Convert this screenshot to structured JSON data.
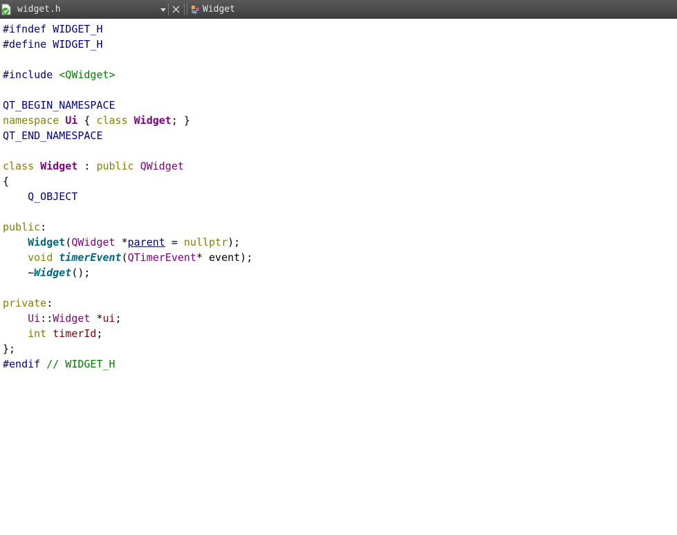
{
  "toolbar": {
    "file_name": "widget.h",
    "symbol_name": "Widget"
  },
  "editor": {
    "lines": [
      [
        {
          "t": "#ifndef WIDGET_H",
          "c": "pp"
        }
      ],
      [
        {
          "t": "#define WIDGET_H",
          "c": "pp"
        }
      ],
      [],
      [
        {
          "t": "#include ",
          "c": "pp"
        },
        {
          "t": "<QWidget>",
          "c": "str"
        }
      ],
      [],
      [
        {
          "t": "QT_BEGIN_NAMESPACE",
          "c": "mac"
        }
      ],
      [
        {
          "t": "namespace",
          "c": "kw"
        },
        {
          "t": " ",
          "c": ""
        },
        {
          "t": "Ui",
          "c": "tyb"
        },
        {
          "t": " { ",
          "c": ""
        },
        {
          "t": "class",
          "c": "kw"
        },
        {
          "t": " ",
          "c": ""
        },
        {
          "t": "Widget",
          "c": "tyb"
        },
        {
          "t": "; }",
          "c": ""
        }
      ],
      [
        {
          "t": "QT_END_NAMESPACE",
          "c": "mac"
        }
      ],
      [],
      [
        {
          "t": "class",
          "c": "kw"
        },
        {
          "t": " ",
          "c": ""
        },
        {
          "t": "Widget",
          "c": "tyb"
        },
        {
          "t": " : ",
          "c": ""
        },
        {
          "t": "public",
          "c": "kw"
        },
        {
          "t": " ",
          "c": ""
        },
        {
          "t": "QWidget",
          "c": "ty"
        }
      ],
      [
        {
          "t": "{",
          "c": ""
        }
      ],
      [
        {
          "t": "    ",
          "c": ""
        },
        {
          "t": "Q_OBJECT",
          "c": "mac"
        }
      ],
      [],
      [
        {
          "t": "public",
          "c": "kw"
        },
        {
          "t": ":",
          "c": ""
        }
      ],
      [
        {
          "t": "    ",
          "c": ""
        },
        {
          "t": "Widget",
          "c": "fn"
        },
        {
          "t": "(",
          "c": ""
        },
        {
          "t": "QWidget",
          "c": "ty"
        },
        {
          "t": " *",
          "c": ""
        },
        {
          "t": "parent",
          "c": "par"
        },
        {
          "t": " = ",
          "c": ""
        },
        {
          "t": "nullptr",
          "c": "kw"
        },
        {
          "t": ");",
          "c": ""
        }
      ],
      [
        {
          "t": "    ",
          "c": ""
        },
        {
          "t": "void",
          "c": "kw"
        },
        {
          "t": " ",
          "c": ""
        },
        {
          "t": "timerEvent",
          "c": "fni"
        },
        {
          "t": "(",
          "c": ""
        },
        {
          "t": "QTimerEvent",
          "c": "ty"
        },
        {
          "t": "* event);",
          "c": ""
        }
      ],
      [
        {
          "t": "    ~",
          "c": ""
        },
        {
          "t": "Widget",
          "c": "fni"
        },
        {
          "t": "();",
          "c": ""
        }
      ],
      [],
      [
        {
          "t": "private",
          "c": "kw"
        },
        {
          "t": ":",
          "c": ""
        }
      ],
      [
        {
          "t": "    ",
          "c": ""
        },
        {
          "t": "Ui",
          "c": "ty"
        },
        {
          "t": "::",
          "c": ""
        },
        {
          "t": "Widget",
          "c": "ty"
        },
        {
          "t": " *",
          "c": ""
        },
        {
          "t": "ui",
          "c": "fld"
        },
        {
          "t": ";",
          "c": ""
        }
      ],
      [
        {
          "t": "    ",
          "c": ""
        },
        {
          "t": "int",
          "c": "kw"
        },
        {
          "t": " ",
          "c": ""
        },
        {
          "t": "timerId",
          "c": "fld"
        },
        {
          "t": ";",
          "c": ""
        }
      ],
      [
        {
          "t": "};",
          "c": ""
        }
      ],
      [
        {
          "t": "#endif",
          "c": "pp"
        },
        {
          "t": " // WIDGET_H",
          "c": "cm"
        }
      ]
    ]
  }
}
